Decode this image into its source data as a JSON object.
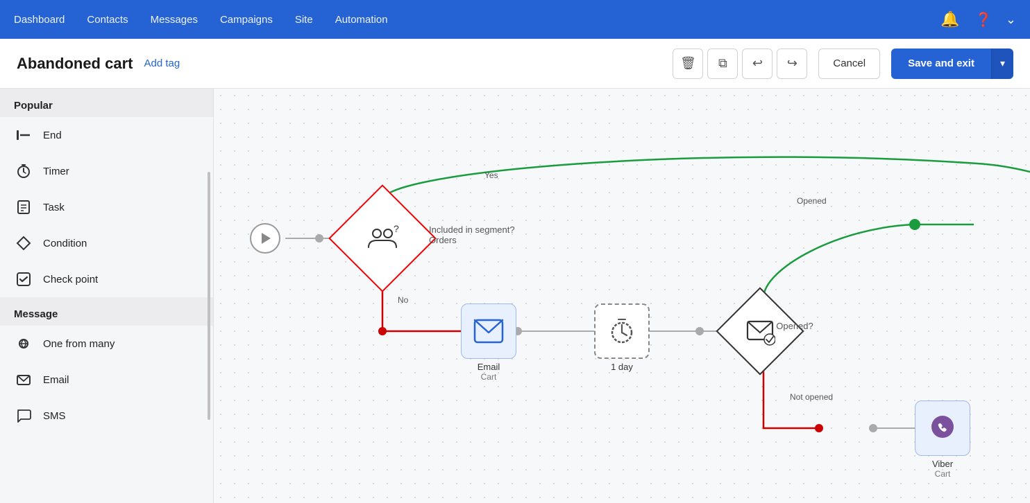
{
  "nav": {
    "links": [
      "Dashboard",
      "Contacts",
      "Messages",
      "Campaigns",
      "Site",
      "Automation"
    ]
  },
  "subheader": {
    "title": "Abandoned cart",
    "add_tag": "Add tag",
    "cancel_label": "Cancel",
    "save_label": "Save and exit"
  },
  "sidebar": {
    "sections": [
      {
        "id": "popular",
        "label": "Popular",
        "items": [
          {
            "id": "end",
            "label": "End",
            "icon": "⊢"
          },
          {
            "id": "timer",
            "label": "Timer",
            "icon": "⏱"
          },
          {
            "id": "task",
            "label": "Task",
            "icon": "📋"
          },
          {
            "id": "condition",
            "label": "Condition",
            "icon": "◇"
          },
          {
            "id": "checkpoint",
            "label": "Check point",
            "icon": "✓"
          }
        ]
      },
      {
        "id": "message",
        "label": "Message",
        "items": [
          {
            "id": "one-from-many",
            "label": "One from many",
            "icon": "✦"
          },
          {
            "id": "email",
            "label": "Email",
            "icon": "✉"
          },
          {
            "id": "sms",
            "label": "SMS",
            "icon": "💬"
          }
        ]
      }
    ]
  },
  "canvas": {
    "nodes": {
      "start": {
        "label": ""
      },
      "condition": {
        "label": "Included in segment?",
        "sublabel": "Orders"
      },
      "email": {
        "label": "Email",
        "sublabel": "Cart"
      },
      "timer": {
        "label": "1 day",
        "sublabel": ""
      },
      "check": {
        "label": "Opened?",
        "sublabel": ""
      },
      "end": {
        "label": ""
      },
      "viber": {
        "label": "Viber",
        "sublabel": "Cart"
      }
    },
    "edge_labels": {
      "yes": "Yes",
      "no": "No",
      "opened": "Opened",
      "not_opened": "Not opened"
    }
  },
  "colors": {
    "primary": "#2563d4",
    "green": "#1a9c3e",
    "red": "#cc0000",
    "gray": "#888888",
    "node_blue_bg": "#e8f0fe",
    "nav_bg": "#2563d4"
  }
}
